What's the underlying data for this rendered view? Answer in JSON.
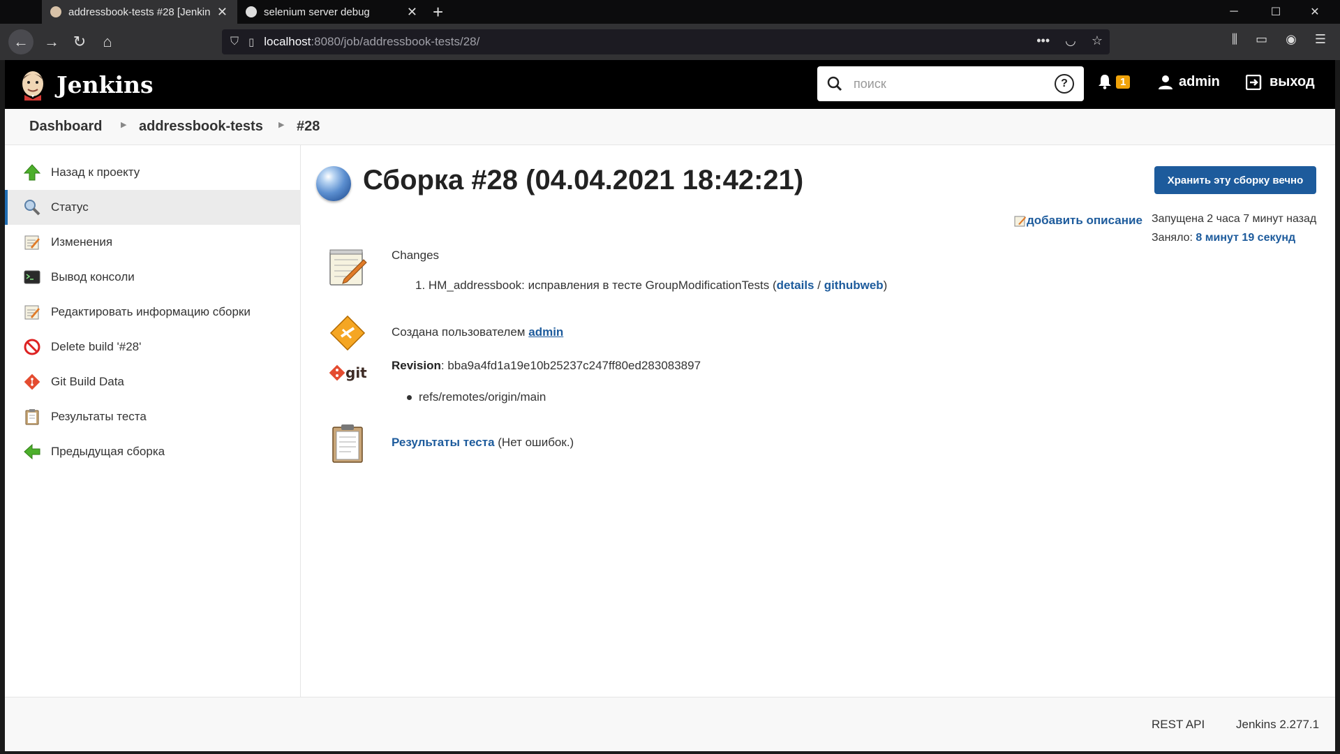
{
  "browser": {
    "tabs": [
      {
        "title": "addressbook-tests #28 [Jenkins]",
        "active": true
      },
      {
        "title": "selenium server debug",
        "active": false
      }
    ],
    "url_host": "localhost",
    "url_path": ":8080/job/addressbook-tests/28/"
  },
  "header": {
    "app_name": "Jenkins",
    "search_placeholder": "поиск",
    "notifications_count": "1",
    "user": "admin",
    "logout": "выход"
  },
  "breadcrumbs": [
    "Dashboard",
    "addressbook-tests",
    "#28"
  ],
  "sidebar": {
    "items": [
      {
        "label": "Назад к проекту",
        "icon": "up-arrow-icon"
      },
      {
        "label": "Статус",
        "icon": "magnifier-icon"
      },
      {
        "label": "Изменения",
        "icon": "notepad-icon"
      },
      {
        "label": "Вывод консоли",
        "icon": "terminal-icon"
      },
      {
        "label": "Редактировать информацию сборки",
        "icon": "notepad-icon"
      },
      {
        "label": "Delete build '#28'",
        "icon": "no-entry-icon"
      },
      {
        "label": "Git Build Data",
        "icon": "git-icon"
      },
      {
        "label": "Результаты теста",
        "icon": "clipboard-icon"
      },
      {
        "label": "Предыдущая сборка",
        "icon": "left-arrow-icon"
      }
    ]
  },
  "main": {
    "title": "Сборка #28 (04.04.2021 18:42:21)",
    "keep_button": "Хранить эту сборку вечно",
    "add_description": "добавить описание",
    "started_label": "Запущена 2 часа 7 минут назад",
    "took_label": "Заняло:",
    "took_value": "8 минут 19 секунд",
    "changes_title": "Changes",
    "change_item": {
      "number": "1.",
      "text": "HM_addressbook: исправления в тесте GroupModificationTests (",
      "details": "details",
      "sep": " / ",
      "githubweb": "githubweb",
      "close": ")"
    },
    "created_by_label": "Создана пользователем",
    "created_by_user": "admin",
    "revision_label": "Revision",
    "revision_hash": "bba9a4fd1a19e10b25237c247ff80ed283083897",
    "ref": "refs/remotes/origin/main",
    "test_results_link": "Результаты теста",
    "test_results_note": "(Нет ошибок.)"
  },
  "footer": {
    "rest_api": "REST API",
    "version": "Jenkins 2.277.1"
  }
}
